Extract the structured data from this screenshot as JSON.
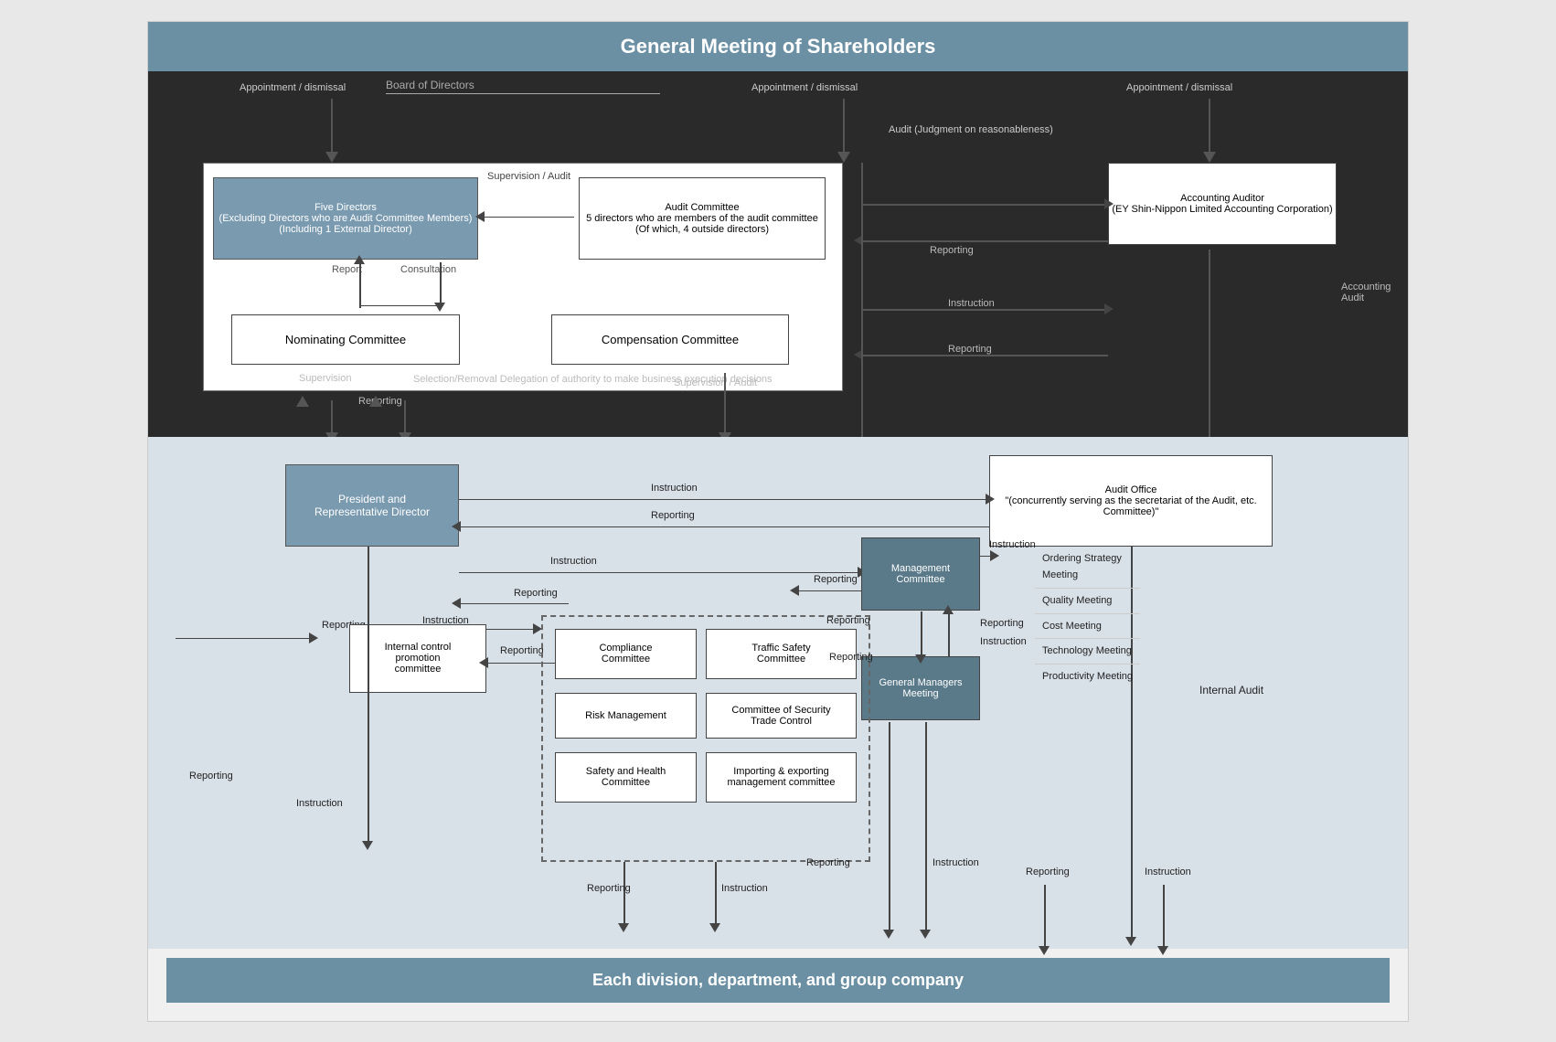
{
  "header": {
    "shareholders": "General Meeting of Shareholders",
    "footer": "Each division, department, and group company"
  },
  "top": {
    "board_label": "Board of Directors",
    "appoint_dismiss_1": "Appointment / dismissal",
    "appoint_dismiss_2": "Appointment / dismissal",
    "appoint_dismiss_3": "Appointment / dismissal",
    "audit_label": "Audit\n(Judgment on reasonableness)",
    "supervision_audit": "Supervision / Audit",
    "report": "Report",
    "consultation": "Consultation",
    "instruction_label": "Instruction",
    "reporting_label": "Reporting",
    "accounting_audit": "Accounting\nAudit",
    "five_directors": "Five Directors\n(Excluding Directors who are Audit Committee Members)\n(Including 1 External Director)",
    "audit_committee": "Audit Committee\n5 directors who are members of the audit committee (Of which, 4 outside directors)",
    "accounting_auditor": "Accounting Auditor\n(EY Shin-Nippon Limited Accounting Corporation)",
    "nominating_committee": "Nominating Committee",
    "compensation_committee": "Compensation Committee",
    "supervision": "Supervision",
    "selection_removal": "Selection/Removal\nDelegation of authority to make\nbusiness execution decisions",
    "reporting2": "Reporting"
  },
  "bottom": {
    "president": "President and\nRepresentative Director",
    "audit_office": "Audit Office\n\"(concurrently serving as the secretariat of the Audit, etc. Committee)\"",
    "management_committee": "Management\nCommittee",
    "general_managers": "General Managers\nMeeting",
    "internal_control": "Internal control\npromotion\ncommittee",
    "instruction_labels": [
      "Instruction",
      "Instruction",
      "Instruction",
      "Instruction",
      "Instruction",
      "Instruction"
    ],
    "reporting_labels": [
      "Reporting",
      "Reporting",
      "Reporting",
      "Reporting",
      "Reporting",
      "Reporting"
    ],
    "internal_audit": "Internal Audit",
    "compliance_committee": "Compliance\nCommittee",
    "traffic_safety": "Traffic Safety\nCommittee",
    "risk_management": "Risk Management",
    "security_trade": "Committee of Security\nTrade Control",
    "safety_health": "Safety and Health\nCommittee",
    "importing_exporting": "Importing & exporting\nmanagement committee",
    "meetings": [
      "Ordering Strategy\nMeeting",
      "Quality Meeting",
      "Cost Meeting",
      "Technology Meeting",
      "Productivity Meeting"
    ]
  }
}
